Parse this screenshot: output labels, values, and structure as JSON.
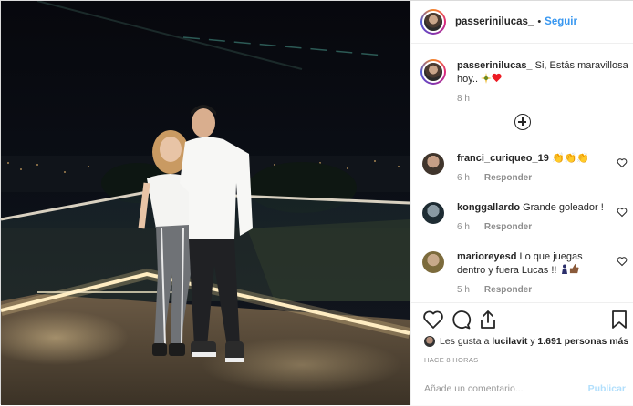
{
  "header": {
    "username": "passerinilucas_",
    "separator": "•",
    "follow_label": "Seguir"
  },
  "caption": {
    "username": "passerinilucas_",
    "text": "Si, Estás maravillosa hoy..",
    "emoji_icons": [
      "sparkle-icon",
      "red-heart-icon"
    ],
    "time": "8 h"
  },
  "load_more_icon": "plus-circle-icon",
  "comments": [
    {
      "username": "franci_curiqueo_19",
      "text": "",
      "emoji_icons": [
        "clapping-hands-icon",
        "clapping-hands-icon",
        "clapping-hands-icon"
      ],
      "time": "6 h",
      "reply": "Responder"
    },
    {
      "username": "konggallardo",
      "text": "Grande goleador !",
      "emoji_icons": [],
      "time": "6 h",
      "reply": "Responder"
    },
    {
      "username": "marioreyesd",
      "text": "Lo que juegas dentro y fuera Lucas !!",
      "emoji_icons": [
        "person-icon",
        "thumbs-up-icon"
      ],
      "time": "5 h",
      "reply": "Responder"
    }
  ],
  "actions": {
    "icons": [
      "heart-icon",
      "comment-icon",
      "share-icon",
      "bookmark-icon"
    ],
    "likes_prefix": "Les gusta a",
    "likes_user": "lucilavit",
    "likes_joiner": "y",
    "likes_count": "1.691 personas más",
    "date": "HACE 8 HORAS"
  },
  "add_comment": {
    "placeholder": "Añade un comentario...",
    "publish_label": "Publicar"
  },
  "colors": {
    "link_blue": "#3897f0",
    "publish_disabled": "#b2dffc",
    "muted_text": "#8e8e8e"
  }
}
